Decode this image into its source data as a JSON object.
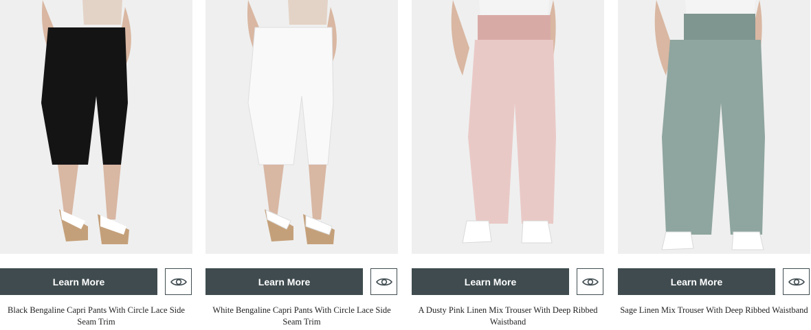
{
  "products": [
    {
      "title": "Black Bengaline Capri Pants With Circle Lace Side Seam Trim",
      "button_label": "Learn More",
      "quick_view_icon": "eye-icon",
      "pants_color": "#141414",
      "style": "capri",
      "footwear": "wedge-sandals"
    },
    {
      "title": "White Bengaline Capri Pants With Circle Lace Side Seam Trim",
      "button_label": "Learn More",
      "quick_view_icon": "eye-icon",
      "pants_color": "#f7f7f8",
      "style": "capri",
      "footwear": "wedge-sandals"
    },
    {
      "title": "A Dusty Pink Linen Mix Trouser With Deep Ribbed Waistband",
      "button_label": "Learn More",
      "quick_view_icon": "eye-icon",
      "pants_color": "#e9c9c6",
      "style": "wide-leg",
      "footwear": "sneakers"
    },
    {
      "title": "Sage Linen Mix Trouser With Deep Ribbed Waistband",
      "button_label": "Learn More",
      "quick_view_icon": "eye-icon",
      "pants_color": "#8fa59f",
      "style": "wide-leg",
      "footwear": "sneakers"
    }
  ],
  "colors": {
    "button_bg": "#3f4b4f",
    "button_text": "#ffffff",
    "photo_bg": "#eeeeef"
  }
}
